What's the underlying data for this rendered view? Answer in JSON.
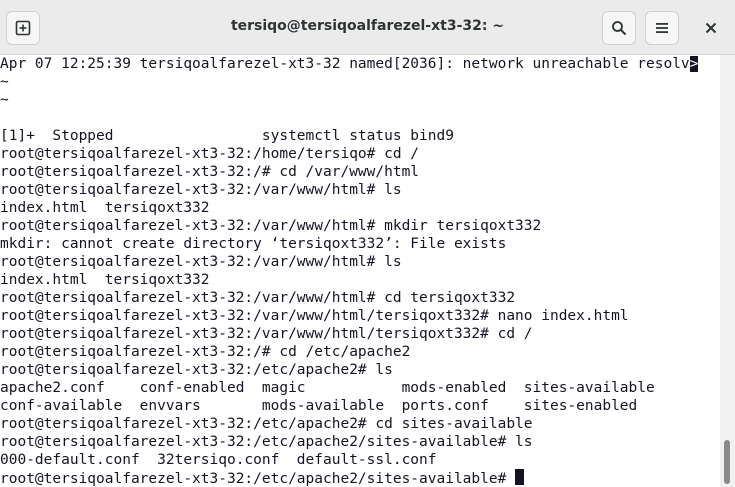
{
  "window": {
    "title": "tersiqo@tersiqoalfarezel-xt3-32: ~",
    "buttons": {
      "new_tab_icon": "new-tab-icon",
      "search_icon": "search-icon",
      "menu_icon": "hamburger-menu-icon",
      "close_label": "✕"
    }
  },
  "terminal": {
    "lines": [
      "Apr 07 12:25:39 tersiqoalfarezel-xt3-32 named[2036]: network unreachable resolv",
      "~",
      "~",
      "",
      "[1]+  Stopped                 systemctl status bind9",
      "root@tersiqoalfarezel-xt3-32:/home/tersiqo# cd /",
      "root@tersiqoalfarezel-xt3-32:/# cd /var/www/html",
      "root@tersiqoalfarezel-xt3-32:/var/www/html# ls",
      "index.html  tersiqoxt332",
      "root@tersiqoalfarezel-xt3-32:/var/www/html# mkdir tersiqoxt332",
      "mkdir: cannot create directory ‘tersiqoxt332’: File exists",
      "root@tersiqoalfarezel-xt3-32:/var/www/html# ls",
      "index.html  tersiqoxt332",
      "root@tersiqoalfarezel-xt3-32:/var/www/html# cd tersiqoxt332",
      "root@tersiqoalfarezel-xt3-32:/var/www/html/tersiqoxt332# nano index.html",
      "root@tersiqoalfarezel-xt3-32:/var/www/html/tersiqoxt332# cd /",
      "root@tersiqoalfarezel-xt3-32:/# cd /etc/apache2",
      "root@tersiqoalfarezel-xt3-32:/etc/apache2# ls",
      "apache2.conf    conf-enabled  magic           mods-enabled  sites-available",
      "conf-available  envvars       mods-available  ports.conf    sites-enabled",
      "root@tersiqoalfarezel-xt3-32:/etc/apache2# cd sites-available",
      "root@tersiqoalfarezel-xt3-32:/etc/apache2/sites-available# ls",
      "000-default.conf  32tersiqo.conf  default-ssl.conf",
      "root@tersiqoalfarezel-xt3-32:/etc/apache2/sites-available# "
    ],
    "overflow_marker": ">",
    "scroll_position": 0.95
  },
  "colors": {
    "foreground": "#171421",
    "background": "#ffffff",
    "titlebar": "#ebebeb"
  }
}
